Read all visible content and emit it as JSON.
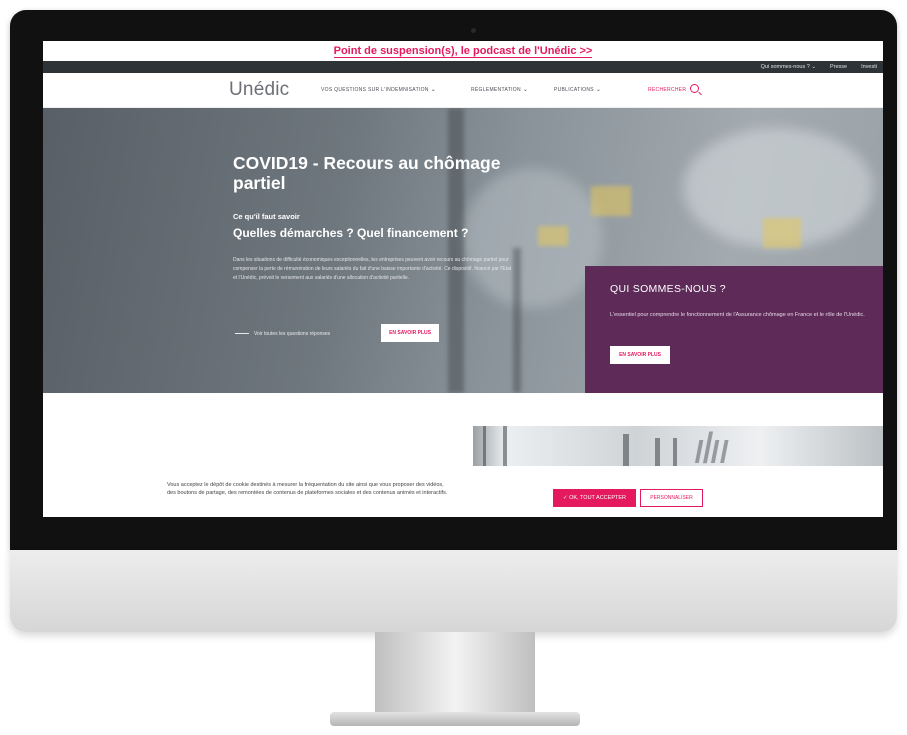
{
  "promo": {
    "text": "Point de suspension(s), le podcast de l'Unédic >>"
  },
  "topbar": {
    "items": [
      "Qui sommes-nous ? ⌄",
      "Presse",
      "Investi"
    ]
  },
  "nav": {
    "logo": "Unédic",
    "items": [
      {
        "label": "Vos questions sur l'indemnisation"
      },
      {
        "label": "Réglementation"
      },
      {
        "label": "Publications"
      }
    ],
    "search_label": "Rechercher",
    "search_icon": "search-icon"
  },
  "hero": {
    "title": "COVID19 - Recours au chômage partiel",
    "kicker": "Ce qu'il faut savoir",
    "subtitle": "Quelles démarches ? Quel financement ?",
    "body": "Dans les situations de difficulté économiques exceptionnelles, les entreprises peuvent avoir recours au chômage partiel pour compenser la perte de rémunération de leurs salariés du fait d'une baisse importante d'activité. Ce dispositif, financé par l'Etat et l'Unédic, prévoit le versement aux salariés d'une allocation d'activité partielle.",
    "link": "Voir toutes les questions réponses",
    "button": "EN SAVOIR PLUS"
  },
  "about": {
    "title": "QUI SOMMES-NOUS ?",
    "text": "L'essentiel pour comprendre le fonctionnement de l'Assurance chômage en France et le rôle de l'Unédic.",
    "button": "EN SAVOIR PLUS"
  },
  "cookie": {
    "text": "Vous acceptez le dépôt de cookie destinés à mesurer la fréquentation du site ainsi que vous proposer des vidéos, des boutons de partage, des remontées de contenus de plateformes sociales et des contenus animés et interactifs.",
    "accept": "✓ OK, TOUT ACCEPTER",
    "customize": "PERSONNALISER"
  },
  "colors": {
    "accent": "#e5195d",
    "purple": "#5e2b59",
    "dark_bar": "#2e3337"
  }
}
